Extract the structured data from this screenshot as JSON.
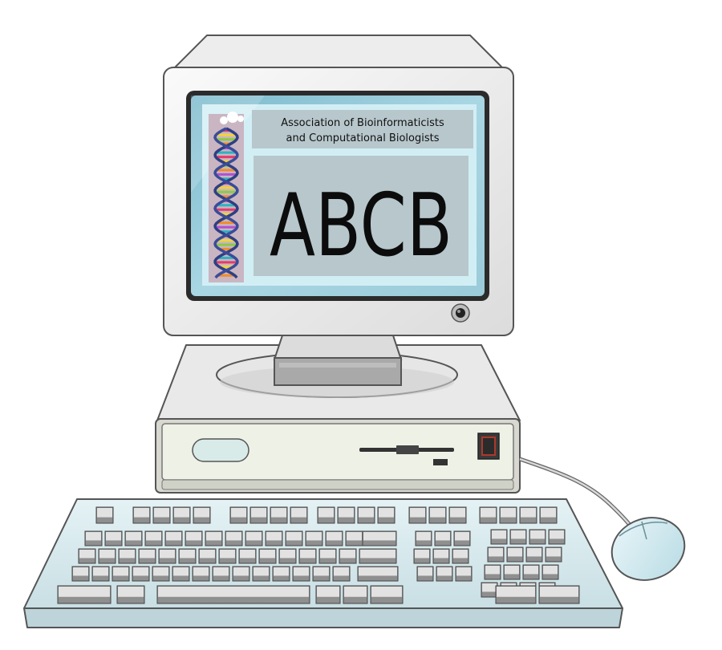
{
  "screen": {
    "org_line1": "Association of Bioinformaticists",
    "org_line2": "and Computational Biologists",
    "logo_text": "ABCB"
  },
  "icons": {
    "dna": "dna-helix-icon",
    "camera": "webcam-icon",
    "floppy": "floppy-drive-slot",
    "power": "power-button"
  },
  "colors": {
    "screen_bg": "#d2eef5",
    "banner_bg": "#b7c7cc",
    "plastic": "#efefef",
    "keyboard": "#d9ebef",
    "case_front": "#eef1e6",
    "power_red": "#c03a2b"
  }
}
